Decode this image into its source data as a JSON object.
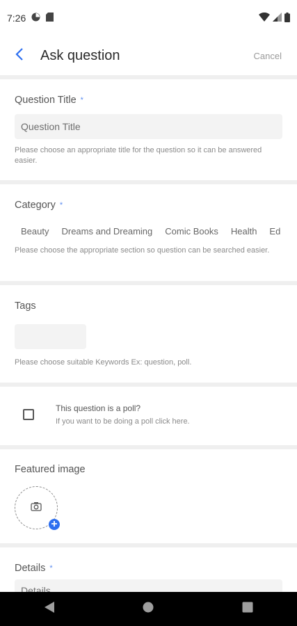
{
  "status_bar": {
    "time": "7:26"
  },
  "app_bar": {
    "title": "Ask question",
    "cancel_label": "Cancel"
  },
  "question_title": {
    "label": "Question Title",
    "required_mark": "*",
    "placeholder": "Question Title",
    "hint": "Please choose an appropriate title for the question so it can be answered easier."
  },
  "category": {
    "label": "Category",
    "required_mark": "*",
    "options": [
      "Beauty",
      "Dreams and Dreaming",
      "Comic Books",
      "Health",
      "Ed"
    ],
    "hint": "Please choose the appropriate section so question can be searched easier."
  },
  "tags": {
    "label": "Tags",
    "hint": "Please choose suitable Keywords Ex: question, poll."
  },
  "poll": {
    "title": "This question is a poll?",
    "subtitle": "If you want to be doing a poll click here."
  },
  "featured_image": {
    "label": "Featured image"
  },
  "details": {
    "label": "Details",
    "required_mark": "*",
    "placeholder": "Details"
  },
  "colors": {
    "accent": "#2d6ff0",
    "separator": "#efefef"
  },
  "icons": {
    "status": [
      "pie-icon",
      "sd-card-icon",
      "wifi-icon",
      "signal-icon",
      "battery-icon"
    ],
    "app_bar": [
      "back-arrow-icon"
    ],
    "featured": [
      "camera-icon",
      "plus-icon"
    ],
    "nav": [
      "back-triangle-icon",
      "home-circle-icon",
      "recents-square-icon"
    ]
  }
}
